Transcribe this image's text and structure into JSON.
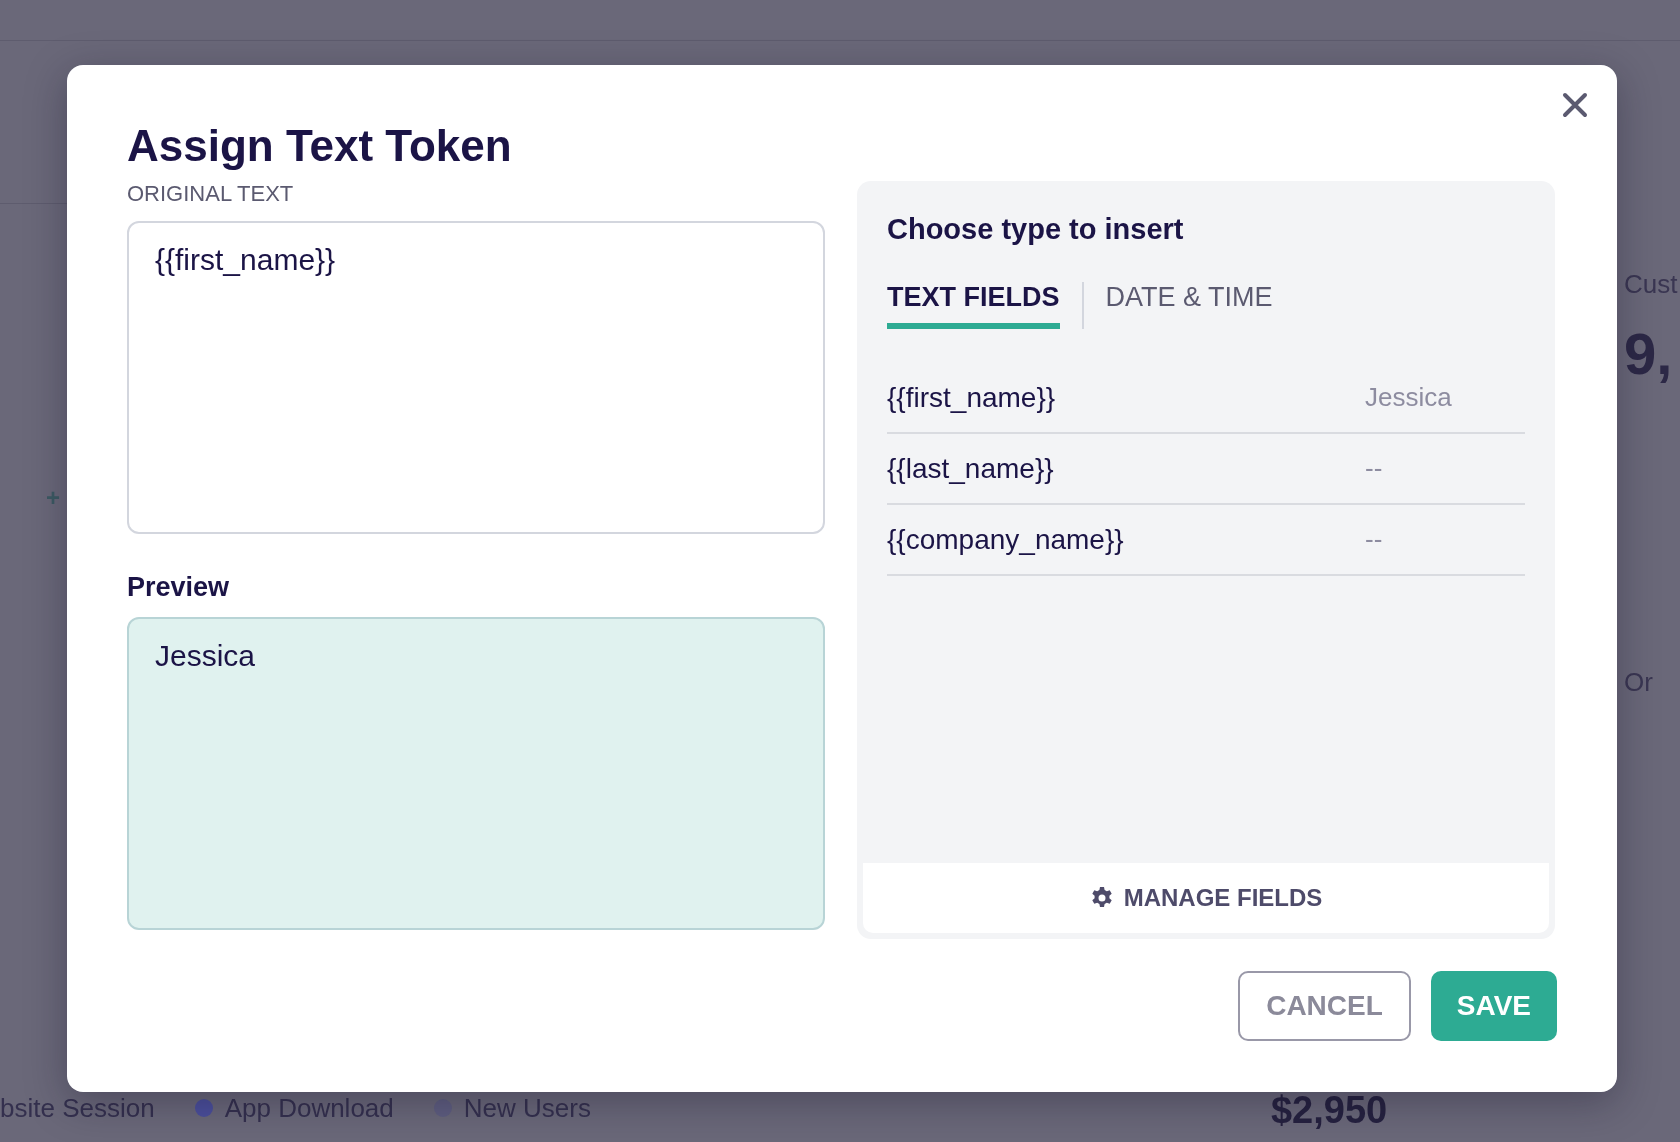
{
  "background": {
    "left_fragments": [
      "+"
    ],
    "right_fragments": [
      "Cust",
      "9,",
      "Or"
    ],
    "legend": [
      {
        "label": "bsite Session"
      },
      {
        "label": "App Download",
        "color": "#4b4f9c"
      },
      {
        "label": "New Users",
        "color": "#5f5e80"
      }
    ],
    "amount": "$2,950"
  },
  "dialog": {
    "title": "Assign Text Token",
    "original_text": {
      "label": "ORIGINAL TEXT",
      "value": "{{first_name}}"
    },
    "preview": {
      "label": "Preview",
      "value": "Jessica"
    },
    "panel": {
      "heading": "Choose type to insert",
      "tabs": [
        {
          "label": "TEXT FIELDS",
          "selected": true
        },
        {
          "label": "DATE & TIME",
          "selected": false
        }
      ],
      "fields": [
        {
          "token": "{{first_name}}",
          "value": "Jessica"
        },
        {
          "token": "{{last_name}}",
          "value": "--"
        },
        {
          "token": "{{company_name}}",
          "value": "--"
        }
      ],
      "manage_button": "MANAGE FIELDS"
    },
    "buttons": [
      {
        "label": "CANCEL",
        "kind": "secondary"
      },
      {
        "label": "SAVE",
        "kind": "primary"
      }
    ]
  }
}
